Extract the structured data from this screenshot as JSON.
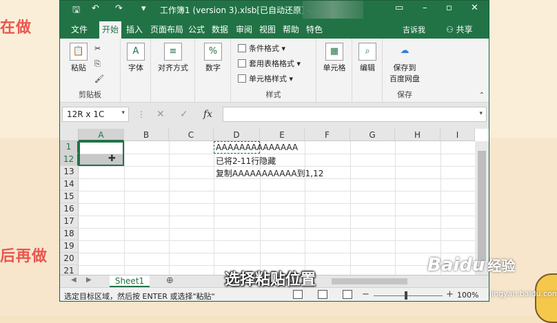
{
  "backdrop": {
    "left_text_top": "在做",
    "left_text_bottom": "后再做"
  },
  "window": {
    "title": "工作簿1 (version 3).xlsb[已自动还原]  -...",
    "quick_access": {
      "save": "🖫",
      "undo": "↶",
      "redo": "↷",
      "customize": "▾"
    },
    "controls": {
      "minimize": "–",
      "restore": "▫",
      "close": "✕"
    }
  },
  "ribbon_tabs": {
    "items": [
      "文件",
      "开始",
      "插入",
      "页面布局",
      "公式",
      "数据",
      "审阅",
      "视图",
      "帮助",
      "特色"
    ],
    "active": "开始",
    "tell_me": "吉诉我",
    "share": "共享"
  },
  "ribbon": {
    "clipboard": {
      "paste": "粘贴",
      "group": "剪贴板"
    },
    "font": {
      "label": "字体"
    },
    "alignment": {
      "label": "对齐方式"
    },
    "number": {
      "label": "数字"
    },
    "styles": {
      "conditional": "条件格式",
      "table": "套用表格格式",
      "cell_styles": "单元格样式",
      "group": "样式"
    },
    "cells": {
      "label": "单元格"
    },
    "editing": {
      "label": "编辑"
    },
    "save": {
      "label_line1": "保存到",
      "label_line2": "百度网盘",
      "group": "保存"
    }
  },
  "formula_bar": {
    "name_box": "12R x 1C",
    "cancel": "✕",
    "enter": "✓",
    "fx": "fx",
    "value": ""
  },
  "grid": {
    "columns": [
      "A",
      "B",
      "C",
      "D",
      "E",
      "F",
      "G",
      "H",
      "I"
    ],
    "selected_column": "A",
    "rows": [
      "1",
      "12",
      "13",
      "14",
      "15",
      "16",
      "17",
      "18",
      "19",
      "20",
      "21"
    ],
    "selected_rows": [
      "1",
      "12"
    ],
    "cells": {
      "D1": "AAAAAAAAAAAAAA",
      "D12": "已将2-11行隐藏",
      "D13": "复制AAAAAAAAAAA到1,12"
    }
  },
  "sheets": {
    "tabs": [
      "Sheet1"
    ],
    "active": "Sheet1",
    "add": "⊕"
  },
  "status": {
    "message": "选定目标区域，然后按 ENTER 或选择\"粘贴\"",
    "zoom": "100%"
  },
  "overlay": {
    "subtitle": "选择粘贴位置",
    "watermark_brand": "Baidu",
    "watermark_cn": "经验",
    "watermark_url": "jingyan.baidu.com"
  },
  "colors": {
    "excel_green": "#217346",
    "backdrop_text": "#e9574f"
  }
}
